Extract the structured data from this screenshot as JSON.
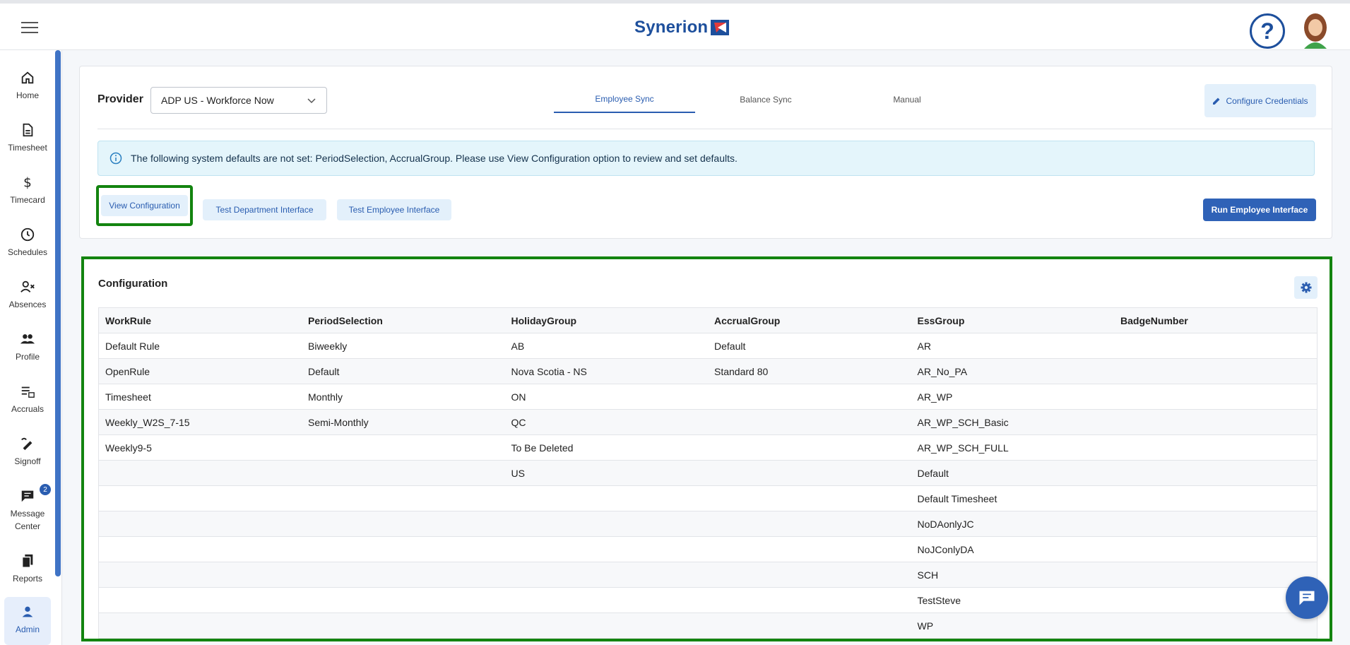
{
  "header": {
    "logo_text": "Synerion"
  },
  "sidebar": {
    "items": [
      {
        "label": "Home",
        "icon": "home-icon"
      },
      {
        "label": "Timesheet",
        "icon": "document-icon"
      },
      {
        "label": "Timecard",
        "icon": "dollar-icon"
      },
      {
        "label": "Schedules",
        "icon": "clock-icon"
      },
      {
        "label": "Absences",
        "icon": "person-x-icon"
      },
      {
        "label": "Profile",
        "icon": "people-icon"
      },
      {
        "label": "Accruals",
        "icon": "list-bank-icon"
      },
      {
        "label": "Signoff",
        "icon": "signoff-icon"
      },
      {
        "label": "Message Center",
        "icon": "chat-icon",
        "badge": "2"
      },
      {
        "label": "Reports",
        "icon": "copy-icon"
      },
      {
        "label": "Admin",
        "icon": "person-icon"
      }
    ]
  },
  "provider": {
    "label": "Provider",
    "selected": "ADP US - Workforce Now",
    "tabs": [
      "Employee Sync",
      "Balance Sync",
      "Manual"
    ],
    "active_tab": "Employee Sync",
    "configure_credentials": "Configure Credentials",
    "alert": "The following system defaults are not set: PeriodSelection, AccrualGroup. Please use View Configuration option to review and set defaults.",
    "buttons": {
      "view_configuration": "View Configuration",
      "test_department": "Test Department Interface",
      "test_employee": "Test Employee Interface",
      "run_employee": "Run Employee Interface"
    }
  },
  "configuration": {
    "title": "Configuration",
    "columns": [
      "WorkRule",
      "PeriodSelection",
      "HolidayGroup",
      "AccrualGroup",
      "EssGroup",
      "BadgeNumber"
    ],
    "rows": [
      [
        "Default Rule",
        "Biweekly",
        "AB",
        "Default",
        "AR",
        ""
      ],
      [
        "OpenRule",
        "Default",
        "Nova Scotia - NS",
        "Standard 80",
        "AR_No_PA",
        ""
      ],
      [
        "Timesheet",
        "Monthly",
        "ON",
        "",
        "AR_WP",
        ""
      ],
      [
        "Weekly_W2S_7-15",
        "Semi-Monthly",
        "QC",
        "",
        "AR_WP_SCH_Basic",
        ""
      ],
      [
        "Weekly9-5",
        "",
        "To Be Deleted",
        "",
        "AR_WP_SCH_FULL",
        ""
      ],
      [
        "",
        "",
        "US",
        "",
        "Default",
        ""
      ],
      [
        "",
        "",
        "",
        "",
        "Default Timesheet",
        ""
      ],
      [
        "",
        "",
        "",
        "",
        "NoDAonlyJC",
        ""
      ],
      [
        "",
        "",
        "",
        "",
        "NoJConlyDA",
        ""
      ],
      [
        "",
        "",
        "",
        "",
        "SCH",
        ""
      ],
      [
        "",
        "",
        "",
        "",
        "TestSteve",
        ""
      ],
      [
        "",
        "",
        "",
        "",
        "WP",
        ""
      ]
    ]
  },
  "colors": {
    "accent": "#2a5db0",
    "highlight": "#13840f",
    "brand": "#1d4f9c"
  }
}
